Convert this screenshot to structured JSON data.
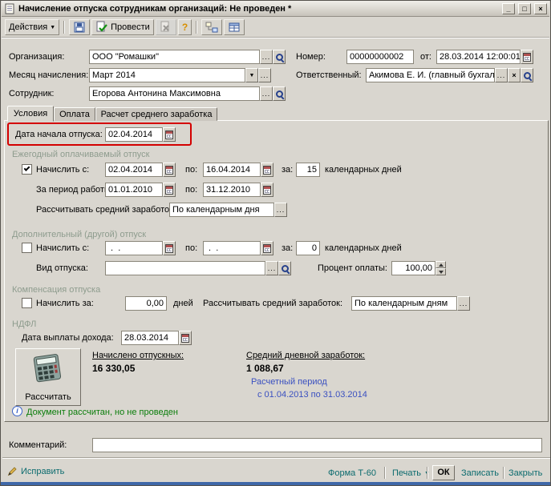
{
  "window": {
    "title": "Начисление отпуска сотрудникам организаций: Не проведен *",
    "controls": {
      "minimize": "_",
      "maximize": "□",
      "close": "×"
    }
  },
  "glyphs": {
    "ellipsis": "...",
    "dropdown": "▼",
    "question": "?",
    "info": "i",
    "clear": "×"
  },
  "toolbar": {
    "actions": "Действия",
    "post": "Провести"
  },
  "header": {
    "organization": {
      "label": "Организация:",
      "value": "ООО \"Ромашки\""
    },
    "number": {
      "label": "Номер:",
      "value": "00000000002"
    },
    "doc_date": {
      "label": "от:",
      "value": "28.03.2014 12:00:01"
    },
    "month": {
      "label": "Месяц начисления:",
      "value": "Март 2014"
    },
    "responsible": {
      "label": "Ответственный:",
      "value": "Акимова Е. И. (главный бухгалте"
    },
    "employee": {
      "label": "Сотрудник:",
      "value": "Егорова Антонина Максимовна"
    }
  },
  "tabs": {
    "conditions": "Условия",
    "payment": "Оплата",
    "avg_calc": "Расчет среднего заработка"
  },
  "conditions": {
    "start_date": {
      "label": "Дата начала отпуска:",
      "value": "02.04.2014"
    },
    "annual": {
      "title": "Ежегодный оплачиваемый отпуск",
      "accrue": {
        "label": "Начислить с:",
        "from": "02.04.2014",
        "to_label": "по:",
        "to": "16.04.2014",
        "for_label": "за:",
        "days": "15",
        "suffix": "календарных дней"
      },
      "work_period": {
        "label": "За период работы с:",
        "from": "01.01.2010",
        "to_label": "по:",
        "to": "31.12.2010"
      },
      "avg_earnings": {
        "label": "Рассчитывать средний заработок:",
        "value": "По календарным дня"
      }
    },
    "additional": {
      "title": "Дополнительный (другой) отпуск",
      "accrue": {
        "label": "Начислить с:",
        "from": " .  .",
        "to_label": "по:",
        "to": " .  .",
        "for_label": "за:",
        "days": "0",
        "suffix": "календарных дней"
      },
      "vacation_type": {
        "label": "Вид отпуска:",
        "value": ""
      },
      "pay_percent": {
        "label": "Процент оплаты:",
        "value": "100,00"
      }
    },
    "compensation": {
      "title": "Компенсация отпуска",
      "accrue": {
        "label": "Начислить за:",
        "value": "0,00",
        "suffix": "дней"
      },
      "avg_earnings": {
        "label": "Рассчитывать средний заработок:",
        "value": "По календарным дням"
      }
    },
    "ndfl": {
      "title": "НДФЛ",
      "payout_date": {
        "label": "Дата выплаты дохода:",
        "value": "28.03.2014"
      }
    },
    "calc_button": "Рассчитать",
    "results": {
      "accrued_label": "Начислено отпускных:",
      "accrued_value": "16 330,05",
      "avg_daily_label": "Средний дневной заработок:",
      "avg_daily_value": "1 088,67",
      "calc_period_link": "Расчетный период",
      "calc_period_range": "с 01.04.2013 по 31.03.2014"
    },
    "status": "Документ рассчитан, но не проведен"
  },
  "comment": {
    "label": "Комментарий:",
    "value": ""
  },
  "footer": {
    "fix": "Исправить",
    "t60": "Форма Т-60",
    "print": "Печать",
    "ok": "ОК",
    "save": "Записать",
    "close": "Закрыть"
  }
}
